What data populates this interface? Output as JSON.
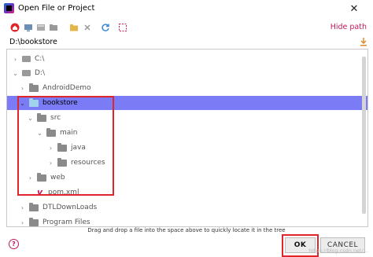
{
  "window": {
    "title": "Open File or Project",
    "close_glyph": "✕"
  },
  "toolbar": {
    "icons": [
      "home-icon",
      "desktop-icon",
      "project-icon",
      "module-icon",
      "new-folder-icon",
      "delete-icon",
      "refresh-icon",
      "show-hidden-icon"
    ],
    "hide_path_label": "Hide path"
  },
  "path": {
    "value": "D:\\bookstore"
  },
  "tree": {
    "items": [
      {
        "label": "C:\\",
        "level": 0,
        "expanded": false,
        "kind": "drive"
      },
      {
        "label": "D:\\",
        "level": 0,
        "expanded": true,
        "kind": "drive"
      },
      {
        "label": "AndroidDemo",
        "level": 1,
        "expanded": false,
        "kind": "folder"
      },
      {
        "label": "bookstore",
        "level": 1,
        "expanded": true,
        "kind": "folder",
        "selected": true
      },
      {
        "label": "src",
        "level": 2,
        "expanded": true,
        "kind": "folder"
      },
      {
        "label": "main",
        "level": 3,
        "expanded": true,
        "kind": "folder"
      },
      {
        "label": "java",
        "level": 4,
        "expanded": false,
        "kind": "folder"
      },
      {
        "label": "resources",
        "level": 4,
        "expanded": false,
        "kind": "folder"
      },
      {
        "label": "web",
        "level": 2,
        "expanded": false,
        "kind": "folder"
      },
      {
        "label": "pom.xml",
        "level": 2,
        "kind": "maven"
      },
      {
        "label": "DTLDownLoads",
        "level": 1,
        "expanded": false,
        "kind": "folder"
      },
      {
        "label": "Program Files",
        "level": 1,
        "expanded": false,
        "kind": "folder"
      }
    ]
  },
  "hint": "Drag and drop a file into the space above to quickly locate it in the tree",
  "buttons": {
    "ok": "OK",
    "cancel": "CANCEL",
    "help": "?"
  },
  "watermark": "https://blog.csdn.net/..."
}
